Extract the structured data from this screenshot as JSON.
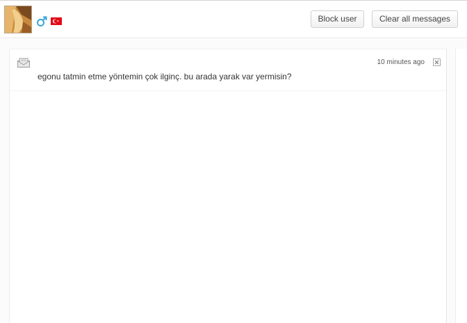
{
  "header": {
    "avatar_icon": "user-avatar-photo",
    "gender_icon": "male-symbol-icon",
    "flag_icon": "turkey-flag-icon",
    "block_user_label": "Block user",
    "clear_all_label": "Clear all messages"
  },
  "messages": [
    {
      "icon": "envelope-icon",
      "time": "10 minutes ago",
      "text": "egonu tatmin etme yöntemin çok ilginç. bu arada yarak var yermisin?"
    }
  ],
  "colors": {
    "gender_icon": "#3aa7d6",
    "flag_red": "#e30a17",
    "border": "#cfcfcf"
  }
}
